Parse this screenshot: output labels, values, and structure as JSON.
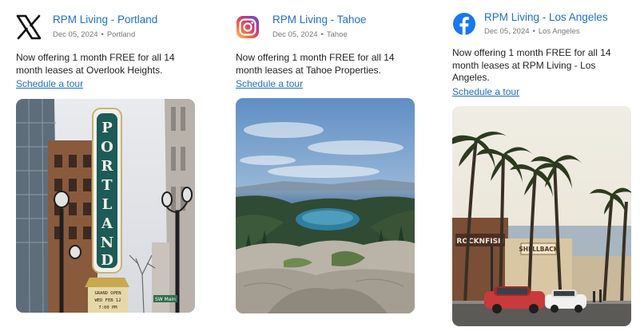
{
  "posts": [
    {
      "platform_icon": "x-logo-icon",
      "account": "RPM Living - Portland",
      "date": "Dec 05, 2024",
      "location": "Portland",
      "text": "Now offering 1 month FREE for all 14 month leases at Overlook Heights.",
      "link": "Schedule a tour",
      "photo_sign": "PORTLAND",
      "photo_marquee": [
        "GRAND OPEN",
        "WED FEB 12",
        "7:00 PM"
      ],
      "street_sign": "SW Main"
    },
    {
      "platform_icon": "instagram-logo-icon",
      "account": "RPM Living - Tahoe",
      "date": "Dec 05, 2024",
      "location": "Tahoe",
      "text": "Now offering 1 month FREE for all 14 month leases at Tahoe Properties.",
      "link": "Schedule a tour"
    },
    {
      "platform_icon": "facebook-logo-icon",
      "account": "RPM Living - Los Angeles",
      "date": "Dec 05, 2024",
      "location": "Los Angeles",
      "text": "Now offering 1 month FREE for all 14 month leases at RPM Living - Los Angeles.",
      "link": "Schedule a tour",
      "photo_signs": [
        "ROCKNFISH",
        "SHELLBACK"
      ]
    }
  ],
  "colors": {
    "link": "#1f6fc5",
    "facebook": "#1877f2"
  }
}
